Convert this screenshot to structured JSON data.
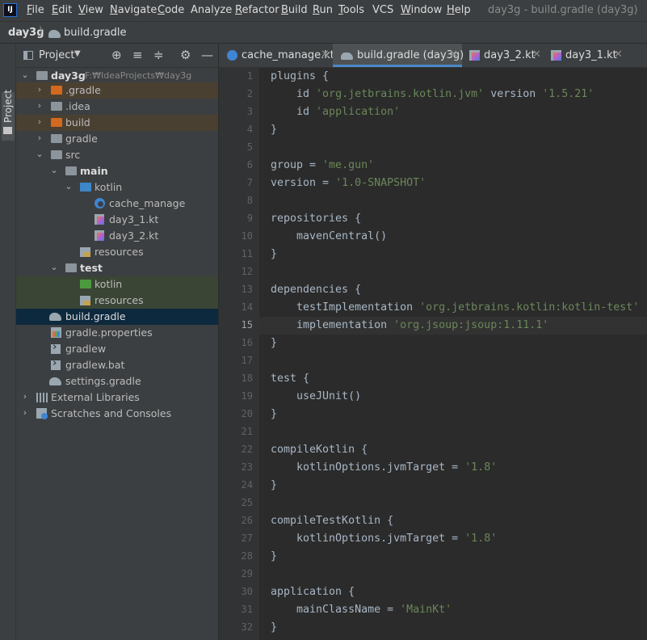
{
  "menubar": {
    "items": [
      {
        "label": "File",
        "m": "F",
        "rest": "ile"
      },
      {
        "label": "Edit",
        "m": "E",
        "rest": "dit"
      },
      {
        "label": "View",
        "m": "V",
        "rest": "iew"
      },
      {
        "label": "Navigate",
        "m": "N",
        "rest": "avigate"
      },
      {
        "label": "Code",
        "m": "C",
        "rest": "ode"
      },
      {
        "label": "Analyze",
        "m": "",
        "rest": "Analyze"
      },
      {
        "label": "Refactor",
        "m": "R",
        "rest": "efactor"
      },
      {
        "label": "Build",
        "m": "B",
        "rest": "uild"
      },
      {
        "label": "Run",
        "m": "R",
        "rest": "un"
      },
      {
        "label": "Tools",
        "m": "T",
        "rest": "ools"
      },
      {
        "label": "VCS",
        "m": "",
        "rest": "VCS"
      },
      {
        "label": "Window",
        "m": "W",
        "rest": "indow"
      },
      {
        "label": "Help",
        "m": "H",
        "rest": "elp"
      }
    ],
    "window_title": "day3g - build.gradle (day3g)"
  },
  "breadcrumb": {
    "project": "day3g",
    "file": "build.gradle"
  },
  "toolstrip": {
    "project_label": "Project"
  },
  "project_panel": {
    "title": "Project",
    "tree": [
      {
        "label": "day3g",
        "path": "F:₩IdeaProjects₩day3g"
      },
      {
        "label": ".gradle"
      },
      {
        "label": ".idea"
      },
      {
        "label": "build"
      },
      {
        "label": "gradle"
      },
      {
        "label": "src"
      },
      {
        "label": "main"
      },
      {
        "label": "kotlin"
      },
      {
        "label": "cache_manage"
      },
      {
        "label": "day3_1.kt"
      },
      {
        "label": "day3_2.kt"
      },
      {
        "label": "resources"
      },
      {
        "label": "test"
      },
      {
        "label": "kotlin"
      },
      {
        "label": "resources"
      },
      {
        "label": "build.gradle"
      },
      {
        "label": "gradle.properties"
      },
      {
        "label": "gradlew"
      },
      {
        "label": "gradlew.bat"
      },
      {
        "label": "settings.gradle"
      },
      {
        "label": "External Libraries"
      },
      {
        "label": "Scratches and Consoles"
      }
    ]
  },
  "tabs": [
    {
      "label": "cache_manage.kt",
      "icon": "cache-icon"
    },
    {
      "label": "build.gradle (day3g)",
      "icon": "gradle-icon",
      "active": true
    },
    {
      "label": "day3_2.kt",
      "icon": "kotlin-file-icon"
    },
    {
      "label": "day3_1.kt",
      "icon": "kotlin-file-icon"
    }
  ],
  "editor": {
    "current_line": 15,
    "line_numbers": [
      "1",
      "2",
      "3",
      "4",
      "5",
      "6",
      "7",
      "8",
      "9",
      "10",
      "11",
      "12",
      "13",
      "14",
      "15",
      "16",
      "17",
      "18",
      "19",
      "20",
      "21",
      "22",
      "23",
      "24",
      "25",
      "26",
      "27",
      "28",
      "29",
      "30",
      "31",
      "32"
    ],
    "lines": [
      [
        [
          "plugins {",
          ""
        ]
      ],
      [
        [
          "    id ",
          ""
        ],
        [
          "'org.jetbrains.kotlin.jvm'",
          "s"
        ],
        [
          " version ",
          ""
        ],
        [
          "'1.5.21'",
          "s"
        ]
      ],
      [
        [
          "    id ",
          ""
        ],
        [
          "'application'",
          "s"
        ]
      ],
      [
        [
          "}",
          ""
        ]
      ],
      [
        [
          "",
          ""
        ]
      ],
      [
        [
          "group = ",
          ""
        ],
        [
          "'me.gun'",
          "s"
        ]
      ],
      [
        [
          "version = ",
          ""
        ],
        [
          "'1.0-SNAPSHOT'",
          "s"
        ]
      ],
      [
        [
          "",
          ""
        ]
      ],
      [
        [
          "repositories {",
          ""
        ]
      ],
      [
        [
          "    mavenCentral()",
          ""
        ]
      ],
      [
        [
          "}",
          ""
        ]
      ],
      [
        [
          "",
          ""
        ]
      ],
      [
        [
          "dependencies {",
          ""
        ]
      ],
      [
        [
          "    testImplementation ",
          ""
        ],
        [
          "'org.jetbrains.kotlin:kotlin-test'",
          "s"
        ]
      ],
      [
        [
          "    implementation ",
          ""
        ],
        [
          "'org.jsoup:jsoup:1.11.1'",
          "s"
        ]
      ],
      [
        [
          "}",
          ""
        ]
      ],
      [
        [
          "",
          ""
        ]
      ],
      [
        [
          "test {",
          ""
        ]
      ],
      [
        [
          "    useJUnit()",
          ""
        ]
      ],
      [
        [
          "}",
          ""
        ]
      ],
      [
        [
          "",
          ""
        ]
      ],
      [
        [
          "compileKotlin {",
          ""
        ]
      ],
      [
        [
          "    kotlinOptions.jvmTarget = ",
          ""
        ],
        [
          "'1.8'",
          "s"
        ]
      ],
      [
        [
          "}",
          ""
        ]
      ],
      [
        [
          "",
          ""
        ]
      ],
      [
        [
          "compileTestKotlin {",
          ""
        ]
      ],
      [
        [
          "    kotlinOptions.jvmTarget = ",
          ""
        ],
        [
          "'1.8'",
          "s"
        ]
      ],
      [
        [
          "}",
          ""
        ]
      ],
      [
        [
          "",
          ""
        ]
      ],
      [
        [
          "application {",
          ""
        ]
      ],
      [
        [
          "    mainClassName = ",
          ""
        ],
        [
          "'MainKt'",
          "s"
        ]
      ],
      [
        [
          "}",
          ""
        ]
      ]
    ]
  },
  "colors": {
    "string": "#6a8759",
    "text": "#a9b7c6",
    "accent": "#4a88c7",
    "excluded_folder": "#d2691e",
    "test_folder": "#4d9a3e",
    "source_folder": "#3d87c6"
  }
}
